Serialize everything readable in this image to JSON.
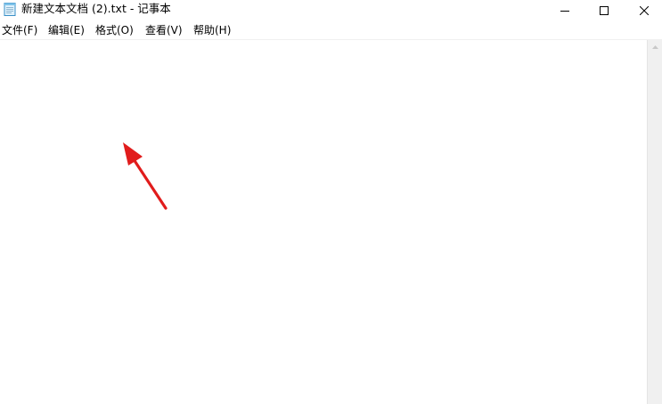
{
  "window": {
    "title": "新建文本文档 (2).txt - 记事本",
    "app_icon": "notepad-icon"
  },
  "caption_buttons": {
    "minimize_icon": "minimize-icon",
    "maximize_icon": "maximize-icon",
    "close_icon": "close-icon"
  },
  "menu": {
    "file": "文件(F)",
    "edit": "编辑(E)",
    "format": "格式(O)",
    "view": "查看(V)",
    "help": "帮助(H)"
  },
  "editor": {
    "content": ""
  },
  "colors": {
    "annotation_arrow": "#e11c1c",
    "scrollbar_bg": "#f0f0f0"
  }
}
